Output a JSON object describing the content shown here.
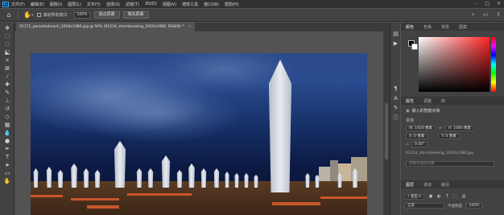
{
  "app": {
    "logo": "Ps",
    "menu": [
      "文件(F)",
      "编辑(E)",
      "图像(I)",
      "图层(L)",
      "文字(Y)",
      "选择(S)",
      "滤镜(T)",
      "3D(D)",
      "视图(V)",
      "增效工具",
      "窗口(W)",
      "帮助(H)"
    ]
  },
  "options": {
    "scroll_all_label": "滚动所有窗口",
    "zoom_value": "100%",
    "fit_screen_label": "适合屏幕",
    "fill_screen_label": "填充屏幕"
  },
  "document": {
    "tab_title": "01171_paradisebeach_1920x1080.jpg @ 50% (01224_stormbrewing_1920x1080, RGB/8) *"
  },
  "panels": {
    "color_tabs": [
      "颜色",
      "色板",
      "渐变",
      "图案"
    ],
    "properties_tabs": [
      "属性",
      "调整",
      "库"
    ],
    "properties_title": "嵌入的智能对象",
    "transform_label": "变换",
    "w_value": "W: 1920 像素",
    "h_value": "H: 1080 像素",
    "x_value": "X: 0 像素",
    "y_value": "Y: 0 像素",
    "angle_value": "0.00°",
    "linked_file": "01224_stormbrewing_1920x1080.jpg",
    "convert_label": "转换为链接对象",
    "layers_tabs": [
      "图层",
      "通道",
      "路径"
    ],
    "kind_label": "类型",
    "blend_mode": "正常",
    "opacity_label": "不透明度:",
    "opacity_value": "100%"
  }
}
